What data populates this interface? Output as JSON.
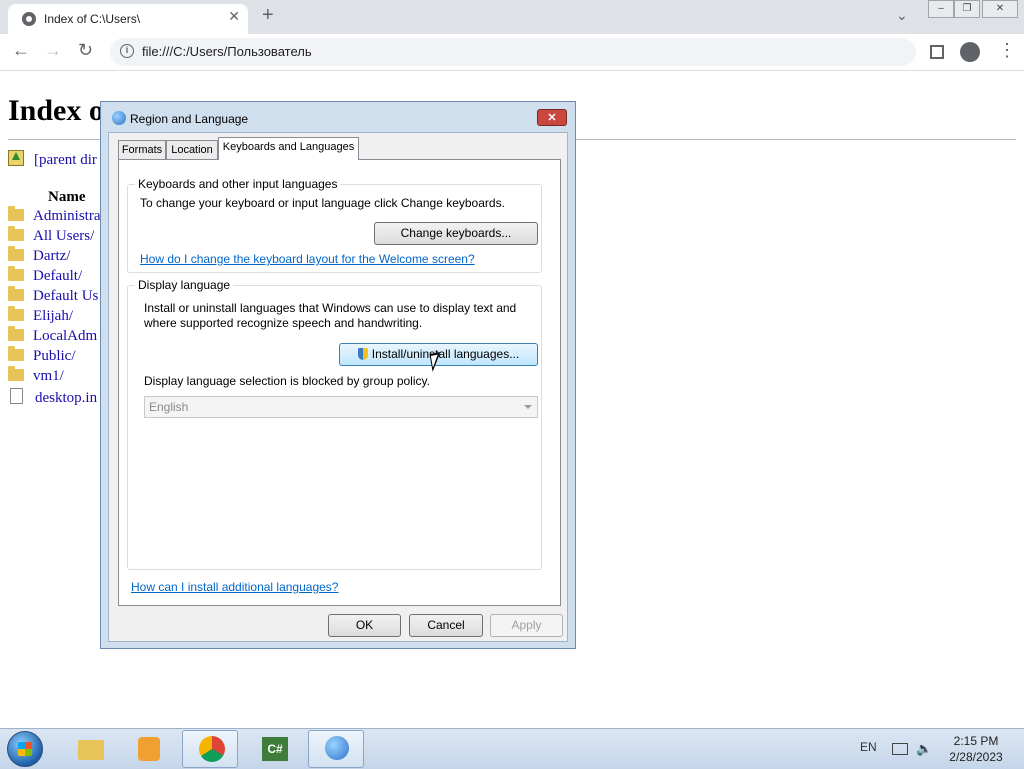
{
  "browser": {
    "tab_title": "Index of C:\\Users\\",
    "tab_close": "✕",
    "new_tab": "+",
    "tab_search": "⌄",
    "win_min": "‒",
    "win_restore": "❐",
    "win_close": "✕",
    "back": "←",
    "forward": "→",
    "reload": "↻",
    "url": "file:///C:/Users/Пользователь",
    "info_glyph": "i",
    "menu": "⋮"
  },
  "page": {
    "title": "Index o",
    "parent_dir": "[parent dir",
    "column_name": "Name",
    "entries": [
      {
        "name": "Administra",
        "type": "folder"
      },
      {
        "name": "All Users/",
        "type": "folder"
      },
      {
        "name": "Dartz/",
        "type": "folder"
      },
      {
        "name": "Default/",
        "type": "folder"
      },
      {
        "name": "Default Us",
        "type": "folder"
      },
      {
        "name": "Elijah/",
        "type": "folder"
      },
      {
        "name": "LocalAdm",
        "type": "folder"
      },
      {
        "name": "Public/",
        "type": "folder"
      },
      {
        "name": "vm1/",
        "type": "folder"
      },
      {
        "name": "desktop.in",
        "type": "file"
      }
    ]
  },
  "dialog": {
    "title": "Region and Language",
    "close": "✕",
    "tabs": [
      "Formats",
      "Location",
      "Keyboards and Languages"
    ],
    "active_tab": "Keyboards and Languages",
    "keyboards_group": {
      "label": "Keyboards and other input languages",
      "text": "To change your keyboard or input language click Change keyboards.",
      "button": "Change keyboards...",
      "link": "How do I change the keyboard layout for the Welcome screen?"
    },
    "display_group": {
      "label": "Display language",
      "text_line1": "Install or uninstall languages that Windows can use to display text and",
      "text_line2": "where supported recognize speech and handwriting.",
      "button": "Install/uninstall languages...",
      "blocked_text": "Display language selection is blocked by group policy.",
      "selected_language": "English"
    },
    "bottom_link": "How can I install additional languages?",
    "buttons": {
      "ok": "OK",
      "cancel": "Cancel",
      "apply": "Apply"
    }
  },
  "taskbar": {
    "language": "EN",
    "time": "2:15 PM",
    "date": "2/28/2023",
    "items": [
      "start",
      "explorer",
      "media-player",
      "chrome",
      "csharp",
      "region-language"
    ],
    "csharp_label": "C#"
  },
  "colors": {
    "link": "#1a0dab",
    "dialog_link": "#0066cc",
    "dialog_frame": "#cfdfee",
    "taskbar": "#c5d6ea"
  }
}
